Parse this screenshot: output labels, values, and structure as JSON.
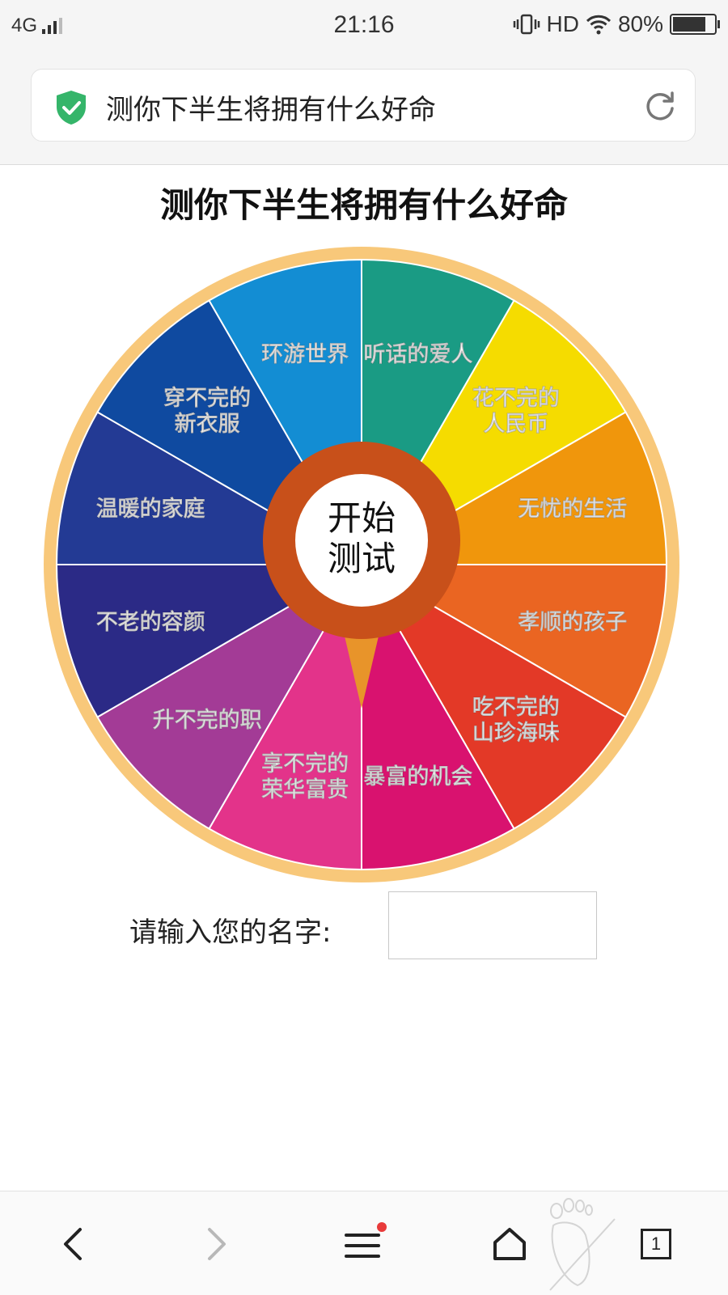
{
  "status_bar": {
    "network": "4G",
    "time": "21:16",
    "hd": "HD",
    "battery": "80%",
    "battery_level": 0.8
  },
  "address_bar": {
    "title": "测你下半生将拥有什么好命"
  },
  "page": {
    "title": "测你下半生将拥有什么好命",
    "center_button": [
      "开始",
      "测试"
    ],
    "wheel_segments": [
      {
        "lines": [
          "听话的爱人"
        ],
        "color": "#1a9b84"
      },
      {
        "lines": [
          "花不完的",
          "人民币"
        ],
        "color": "#f5dc00"
      },
      {
        "lines": [
          "无忧的生活"
        ],
        "color": "#f0960c"
      },
      {
        "lines": [
          "孝顺的孩子"
        ],
        "color": "#ea6522"
      },
      {
        "lines": [
          "吃不完的",
          "山珍海味"
        ],
        "color": "#e33927"
      },
      {
        "lines": [
          "暴富的机会"
        ],
        "color": "#d9126f"
      },
      {
        "lines": [
          "享不完的",
          "荣华富贵"
        ],
        "color": "#e3338a"
      },
      {
        "lines": [
          "升不完的职"
        ],
        "color": "#a33b96"
      },
      {
        "lines": [
          "不老的容颜"
        ],
        "color": "#2b2a86"
      },
      {
        "lines": [
          "温暖的家庭"
        ],
        "color": "#233a94"
      },
      {
        "lines": [
          "穿不完的",
          "新衣服"
        ],
        "color": "#0f4aa0"
      },
      {
        "lines": [
          "环游世界"
        ],
        "color": "#138dd3"
      }
    ],
    "name_label": "请输入您的名字:",
    "name_value": ""
  },
  "bottom_nav": {
    "tab_count": "1"
  },
  "colors": {
    "wheel_rim": "#f8c87a",
    "hub_ring": "#c8501a",
    "secure_green": "#35b56a",
    "notification_dot": "#e83a3a"
  }
}
